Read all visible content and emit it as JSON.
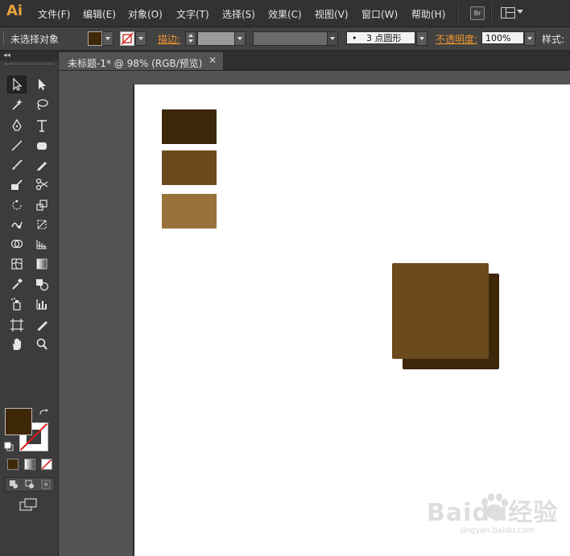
{
  "app": {
    "logo": "Ai"
  },
  "menu": {
    "items": [
      "文件(F)",
      "编辑(E)",
      "对象(O)",
      "文字(T)",
      "选择(S)",
      "效果(C)",
      "视图(V)",
      "窗口(W)",
      "帮助(H)"
    ],
    "bridge_label": "Br"
  },
  "control_bar": {
    "selection_status": "未选择对象",
    "stroke_label": "描边:",
    "brush_value": "3 点圆形",
    "brush_dot": "•",
    "opacity_label": "不透明度:",
    "opacity_value": "100%",
    "style_label": "样式:"
  },
  "tools_panel": {
    "collapse_label": "◂◂",
    "fill_color": "#3f2808",
    "stroke_color": "none"
  },
  "document": {
    "tab_title": "未标题-1* @ 98% (RGB/预览)",
    "close_label": "✕"
  },
  "canvas": {
    "swatches": [
      "#3d2708",
      "#6b4a1d",
      "#98723a"
    ],
    "back_square_color": "#3d2708",
    "front_square_color": "#6b4a1d"
  },
  "watermark": {
    "text": "Baidu经验",
    "subtext": "jingyan.baidu.com"
  }
}
